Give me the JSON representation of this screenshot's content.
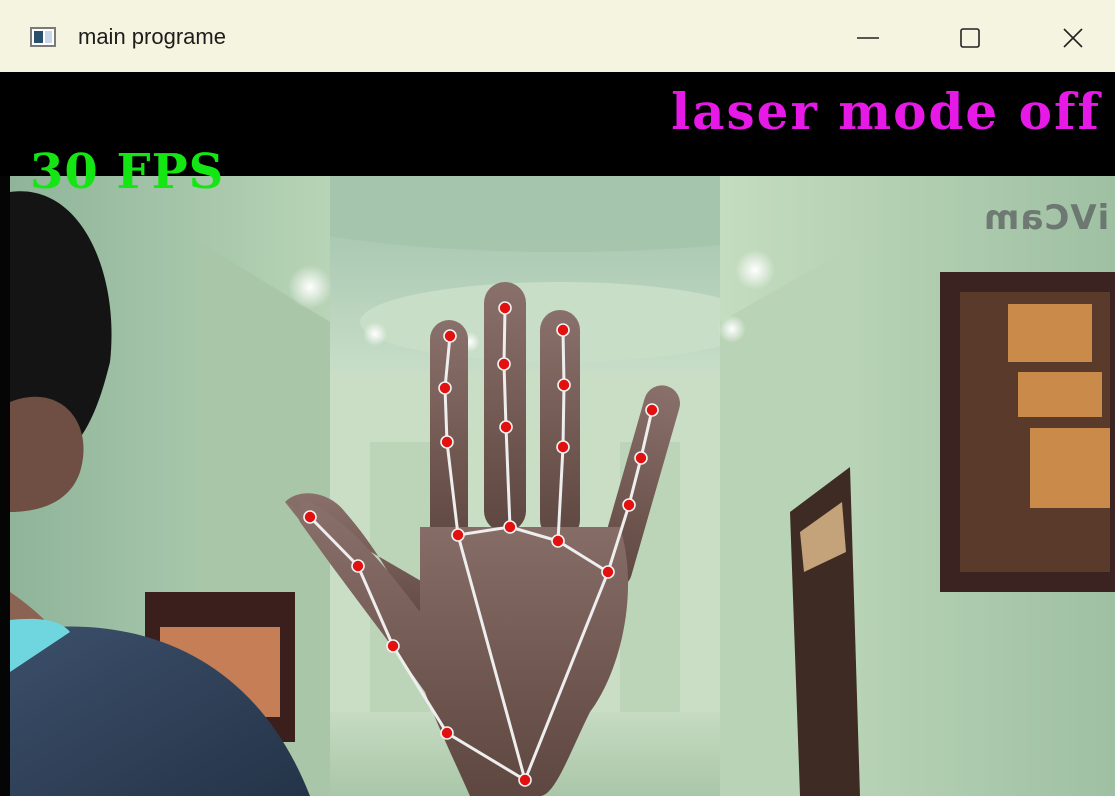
{
  "window": {
    "title": "main programe",
    "icon": "app-window-icon",
    "controls": [
      "minimize-icon",
      "maximize-icon",
      "close-icon"
    ]
  },
  "overlay": {
    "laser_status": "laser mode off",
    "fps": "30 FPS",
    "watermark": "iVCam",
    "colors": {
      "laser": "#e619e6",
      "fps": "#13e613",
      "landmark": "#e31010",
      "connector": "#eeeeee"
    }
  }
}
